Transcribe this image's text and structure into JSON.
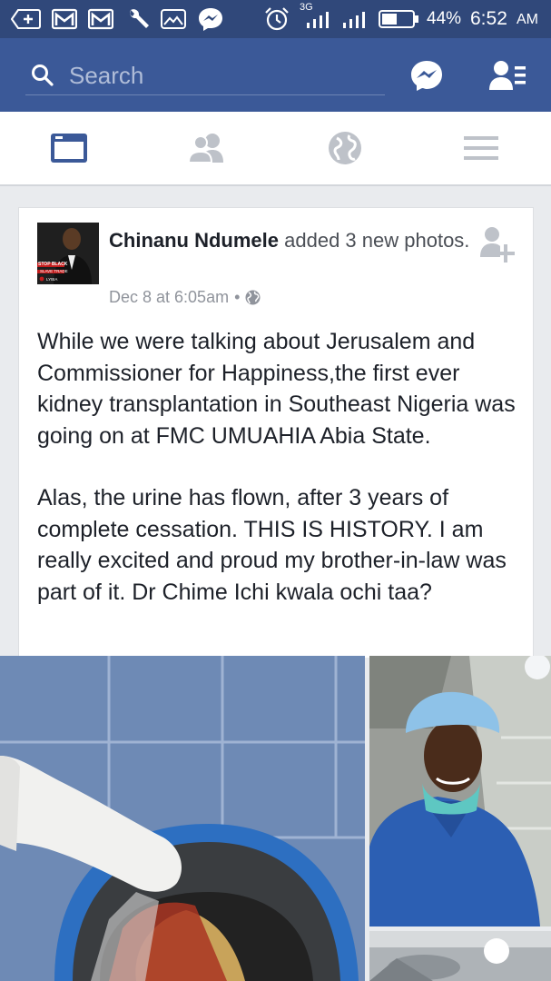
{
  "status_bar": {
    "network": "3G",
    "battery_percent": "44%",
    "time": "6:52",
    "time_suffix": "AM"
  },
  "header": {
    "search_placeholder": "Search"
  },
  "tabs": [
    {
      "name": "news-feed",
      "active": true
    },
    {
      "name": "friends",
      "active": false
    },
    {
      "name": "notifications",
      "active": false
    },
    {
      "name": "menu",
      "active": false
    }
  ],
  "post": {
    "author": "Chinanu Ndumele",
    "action": "added 3 new photos.",
    "timestamp": "Dec 8 at 6:05am",
    "separator": "•",
    "avatar_caption_1": "STOP BLACK",
    "avatar_caption_2": "SLAVE TRADE",
    "avatar_caption_3": "LYBIA",
    "paragraph_1": "While we were talking about Jerusalem and Commissioner for Happiness,the first ever kidney transplantation in Southeast Nigeria was going on at FMC UMUAHIA Abia State.",
    "paragraph_2": "Alas, the urine has flown, after 3 years of complete cessation. THIS IS HISTORY. I am really excited and proud my brother-in-law was  part of it. Dr Chime Ichi kwala ochi taa?"
  },
  "colors": {
    "brand": "#3b5998",
    "status_bar": "#30487a",
    "tab_active": "#3b5998",
    "tab_inactive": "#bec2c9"
  }
}
